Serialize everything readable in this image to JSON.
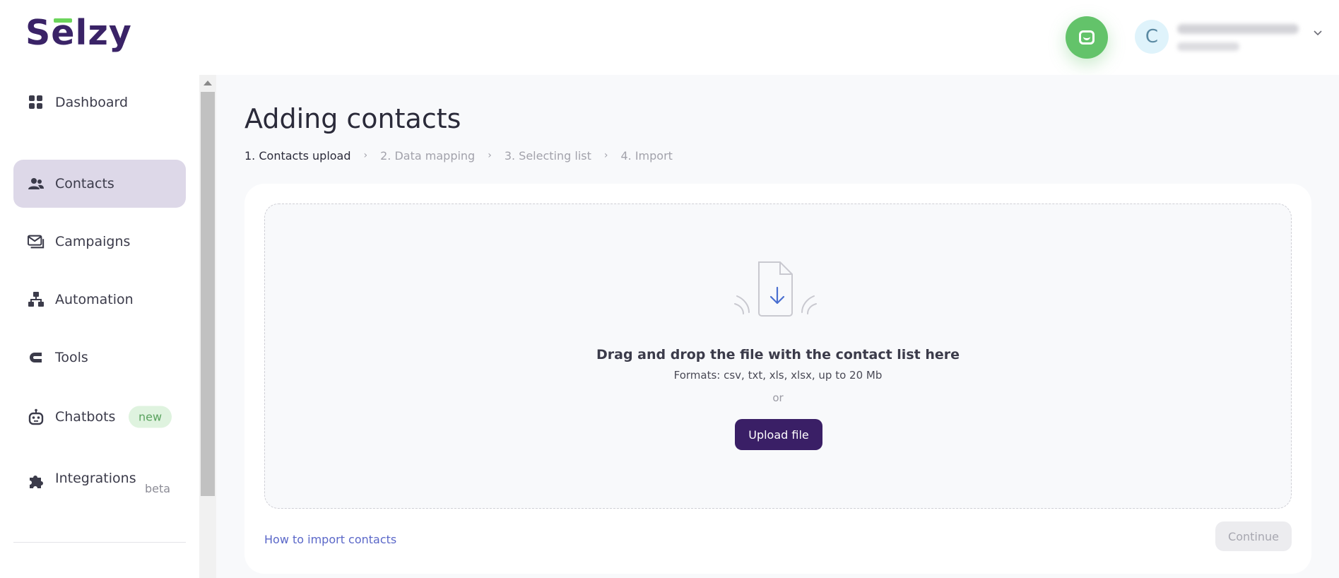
{
  "header": {
    "logo_text": "Selzy",
    "avatar_letter": "C"
  },
  "sidebar": {
    "items": [
      {
        "label": "Dashboard"
      },
      {
        "label": "Contacts"
      },
      {
        "label": "Campaigns"
      },
      {
        "label": "Automation"
      },
      {
        "label": "Tools"
      },
      {
        "label": "Chatbots",
        "badge": "new"
      },
      {
        "label": "Integrations",
        "badge": "beta"
      }
    ]
  },
  "main": {
    "title": "Adding contacts",
    "steps": [
      {
        "label": "1. Contacts upload"
      },
      {
        "label": "2. Data mapping"
      },
      {
        "label": "3. Selecting list"
      },
      {
        "label": "4. Import"
      }
    ],
    "dropzone": {
      "title": "Drag and drop the file with the contact list here",
      "formats": "Formats: csv, txt, xls, xlsx, up to 20 Mb",
      "or": "or",
      "upload_label": "Upload file"
    },
    "help_link": "How to import contacts",
    "continue_label": "Continue"
  },
  "colors": {
    "brand": "#3a2367",
    "accent_green": "#63c36a",
    "active_nav": "#ddd8e8",
    "link": "#5a67c8"
  }
}
